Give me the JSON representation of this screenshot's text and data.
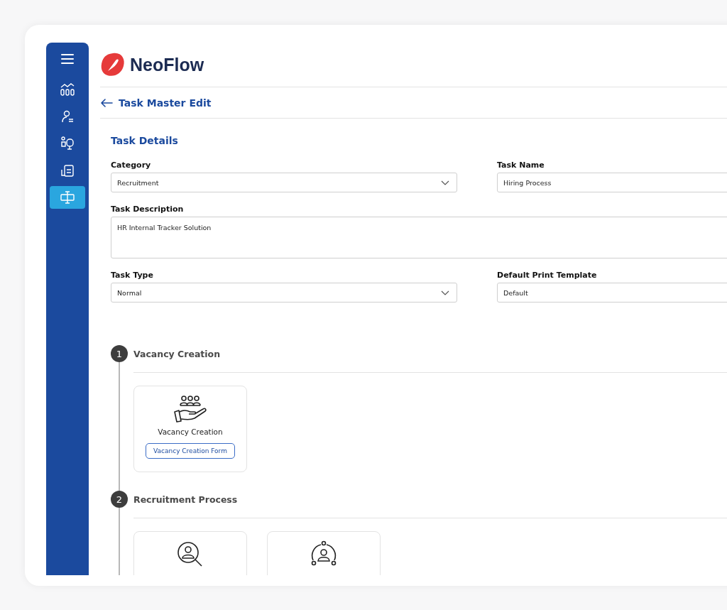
{
  "sidebar": {
    "items": [
      {
        "selected": false
      },
      {
        "selected": false
      },
      {
        "selected": false
      },
      {
        "selected": false
      },
      {
        "selected": true
      }
    ]
  },
  "brand": {
    "name": "NeoFlow"
  },
  "header": {
    "title": "Task Master Edit"
  },
  "section": {
    "title": "Task Details"
  },
  "fields": [
    {
      "label": "Category",
      "value": "Recruitment",
      "kind": "select"
    },
    {
      "label": "Task Name",
      "value": "Hiring Process",
      "kind": "text"
    },
    {
      "label": "Task Description",
      "value": "HR Internal Tracker Solution",
      "kind": "textarea"
    },
    {
      "label": "Task Type",
      "value": "Normal",
      "kind": "select"
    },
    {
      "label": "Default Print Template",
      "value": "Default",
      "kind": "text"
    }
  ],
  "steps": [
    {
      "number": "1",
      "title": "Vacancy Creation",
      "cards": [
        {
          "kind": "full",
          "title": "Vacancy Creation",
          "button": "Vacancy Creation Form"
        }
      ]
    },
    {
      "number": "2",
      "title": "Recruitment Process",
      "cards": [
        {
          "kind": "cut"
        },
        {
          "kind": "cut"
        }
      ]
    }
  ]
}
